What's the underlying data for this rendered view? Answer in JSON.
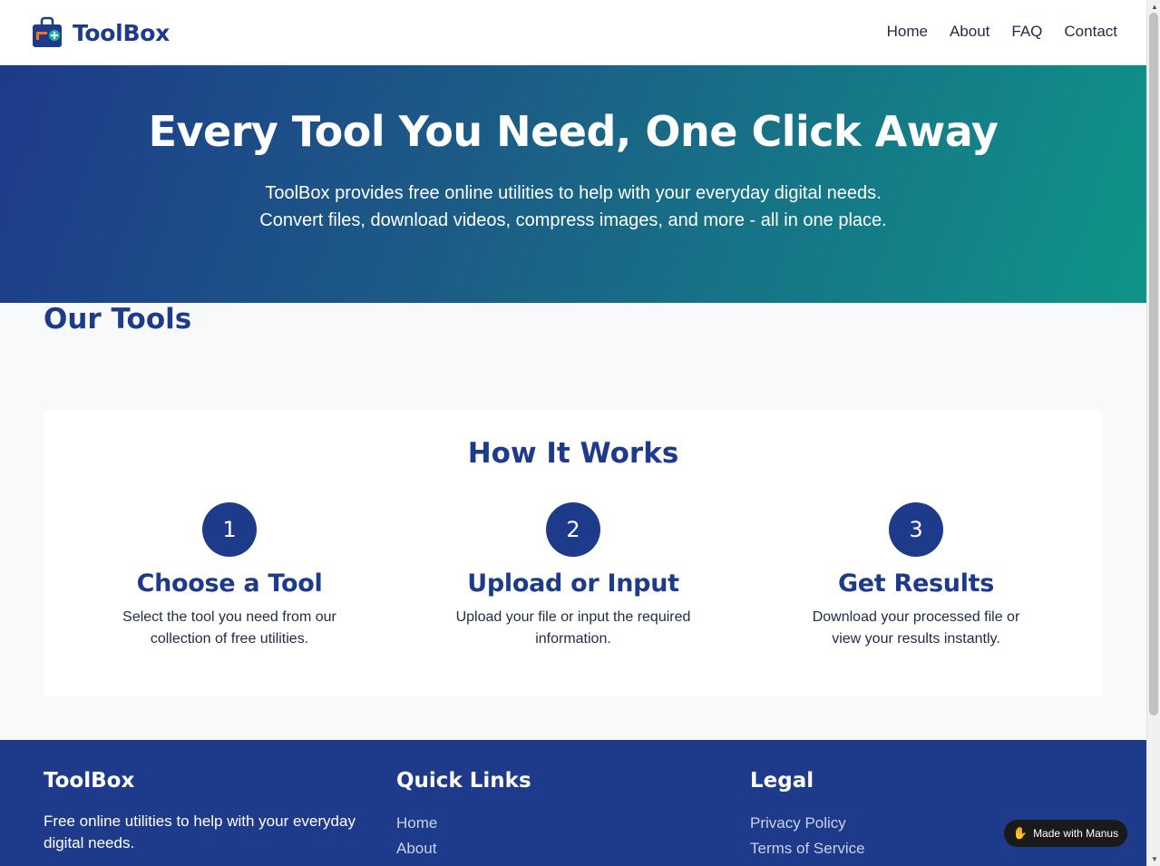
{
  "header": {
    "brand": "ToolBox",
    "logo_icon": "toolbox-icon",
    "nav": [
      "Home",
      "About",
      "FAQ",
      "Contact"
    ]
  },
  "hero": {
    "title": "Every Tool You Need, One Click Away",
    "line1": "ToolBox provides free online utilities to help with your everyday digital needs.",
    "line2": "Convert files, download videos, compress images, and more - all in one place."
  },
  "tools": {
    "title": "Our Tools"
  },
  "how": {
    "title": "How It Works",
    "steps": [
      {
        "num": "1",
        "title": "Choose a Tool",
        "desc": "Select the tool you need from our collection of free utilities."
      },
      {
        "num": "2",
        "title": "Upload or Input",
        "desc": "Upload your file or input the required information."
      },
      {
        "num": "3",
        "title": "Get Results",
        "desc": "Download your processed file or view your results instantly."
      }
    ]
  },
  "footer": {
    "brand": "ToolBox",
    "tagline": "Free online utilities to help with your everyday digital needs.",
    "quick_title": "Quick Links",
    "quick_links": [
      "Home",
      "About"
    ],
    "legal_title": "Legal",
    "legal_links": [
      "Privacy Policy",
      "Terms of Service"
    ]
  },
  "badge": {
    "label": "Made with Manus",
    "icon": "manus-hand-icon"
  },
  "colors": {
    "brand": "#1e3a8a",
    "accent": "#0f9488"
  }
}
